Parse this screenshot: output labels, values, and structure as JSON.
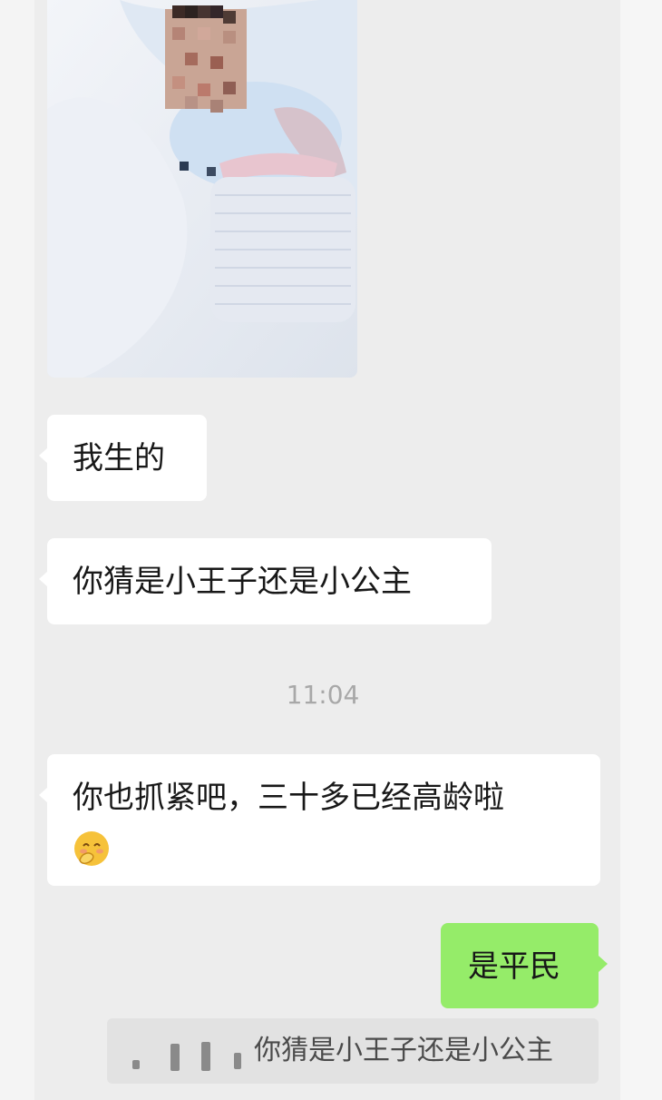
{
  "messages": [
    {
      "side": "left",
      "type": "image",
      "alt": ""
    },
    {
      "side": "left",
      "type": "text",
      "text": "我生的"
    },
    {
      "side": "left",
      "type": "text",
      "text": "你猜是小王子还是小公主"
    },
    {
      "side": "left",
      "type": "text",
      "text": "你也抓紧吧，三十多已经高龄啦",
      "emoji": "shy-smile-emoji"
    },
    {
      "side": "right",
      "type": "text",
      "text": "是平民"
    }
  ],
  "timestamp": "11:04",
  "quote": {
    "text": "你猜是小王子还是小公主",
    "icon": "voice-wave-icon"
  },
  "colors": {
    "background": "#ededed",
    "left_bubble": "#ffffff",
    "right_bubble": "#95ec69",
    "timestamp": "#a8a8a8"
  }
}
